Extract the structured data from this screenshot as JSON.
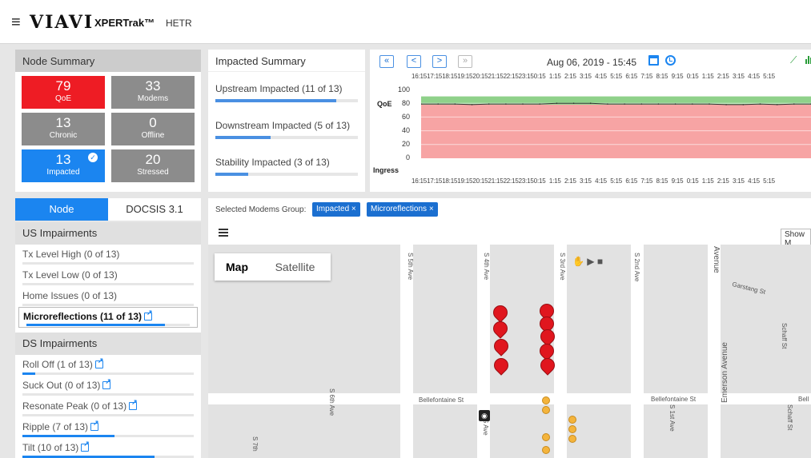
{
  "header": {
    "menu_icon": "≡",
    "logo": "VIAVI",
    "product": "XPERTrak™",
    "subtitle": "HETR"
  },
  "node_summary": {
    "title": "Node Summary",
    "tiles": [
      {
        "value": "79",
        "label": "QoE",
        "color": "#ee1c24"
      },
      {
        "value": "33",
        "label": "Modems",
        "color": "#8c8c8c"
      },
      {
        "value": "13",
        "label": "Chronic",
        "color": "#8c8c8c"
      },
      {
        "value": "0",
        "label": "Offline",
        "color": "#8c8c8c"
      },
      {
        "value": "13",
        "label": "Impacted",
        "color": "#1b85f0"
      },
      {
        "value": "20",
        "label": "Stressed",
        "color": "#8c8c8c"
      }
    ]
  },
  "impacted_summary": {
    "title": "Impacted Summary",
    "items": [
      {
        "label": "Upstream Impacted (11 of 13)",
        "fraction": 0.846
      },
      {
        "label": "Downstream Impacted (5 of 13)",
        "fraction": 0.385
      },
      {
        "label": "Stability Impacted (3 of 13)",
        "fraction": 0.23
      }
    ]
  },
  "chart": {
    "nav": {
      "first": "«",
      "prev": "<",
      "next": ">",
      "last": "»"
    },
    "date": "Aug 06, 2019 - 15:45",
    "hours": [
      "16:15",
      "17:15",
      "18:15",
      "19:15",
      "20:15",
      "21:15",
      "22:15",
      "23:15",
      "0:15",
      "1:15",
      "2:15",
      "3:15",
      "4:15",
      "5:15",
      "6:15",
      "7:15",
      "8:15",
      "9:15",
      "0:15",
      "1:15",
      "2:15",
      "3:15",
      "4:15",
      "5:15"
    ],
    "y_ticks": [
      "100",
      "80",
      "60",
      "40",
      "20",
      "0"
    ],
    "qoe_label": "QoE",
    "ingress_label": "Ingress"
  },
  "chart_data": {
    "type": "area",
    "x": [
      "16:15",
      "17:15",
      "18:15",
      "19:15",
      "20:15",
      "21:15",
      "22:15",
      "23:15",
      "0:15",
      "1:15",
      "2:15",
      "3:15",
      "4:15",
      "5:15",
      "6:15",
      "7:15",
      "8:15",
      "9:15",
      "0:15",
      "1:15",
      "2:15",
      "3:15",
      "4:15",
      "5:15"
    ],
    "series": [
      {
        "values": [
          79,
          79,
          79,
          78,
          79,
          79,
          79,
          79,
          80,
          80,
          80,
          79,
          79,
          79,
          79,
          79,
          79,
          79,
          78,
          78,
          79,
          78,
          79,
          79
        ]
      }
    ],
    "ylim": [
      0,
      100
    ],
    "bands": [
      {
        "from": 0,
        "to": 78,
        "color": "#f7a4a4"
      },
      {
        "from": 78,
        "to": 90,
        "color": "#8fd18a"
      }
    ]
  },
  "tabs": {
    "node": "Node",
    "docsis": "DOCSIS 3.1"
  },
  "us_impairments": {
    "title": "US Impairments",
    "items": [
      {
        "label": "Tx Level High (0 of 13)",
        "fraction": 0,
        "link": false,
        "selected": false
      },
      {
        "label": "Tx Level Low (0 of 13)",
        "fraction": 0,
        "link": false,
        "selected": false
      },
      {
        "label": "Home Issues (0 of 13)",
        "fraction": 0,
        "link": false,
        "selected": false
      },
      {
        "label": "Microreflections (11 of 13)",
        "fraction": 0.846,
        "link": true,
        "selected": true
      }
    ]
  },
  "ds_impairments": {
    "title": "DS Impairments",
    "items": [
      {
        "label": "Roll Off (1 of 13)",
        "fraction": 0.077,
        "link": true,
        "selected": false
      },
      {
        "label": "Suck Out (0 of 13)",
        "fraction": 0,
        "link": true,
        "selected": false
      },
      {
        "label": "Resonate Peak (0 of 13)",
        "fraction": 0,
        "link": true,
        "selected": false
      },
      {
        "label": "Ripple (7 of 13)",
        "fraction": 0.538,
        "link": true,
        "selected": false
      },
      {
        "label": "Tilt (10 of 13)",
        "fraction": 0.769,
        "link": true,
        "selected": false
      }
    ]
  },
  "map_panel": {
    "group_label": "Selected Modems Group:",
    "chips": [
      "Impacted",
      "Microreflections"
    ],
    "chip_close": "×",
    "show_button": "Show M",
    "map_tab": "Map",
    "satellite_tab": "Satellite",
    "streets": [
      "S 5th Ave",
      "S 4th Ave",
      "S 3rd Ave",
      "S 2nd Ave",
      "Avenue",
      "Garstang St",
      "Schaff St",
      "Emerson Avenue",
      "Bellefontaine St",
      "Bellefontaine St",
      "Bell",
      "S 1st Ave",
      "S 6th Ave",
      "S 7th",
      "Schaff St",
      "S Ave"
    ]
  }
}
